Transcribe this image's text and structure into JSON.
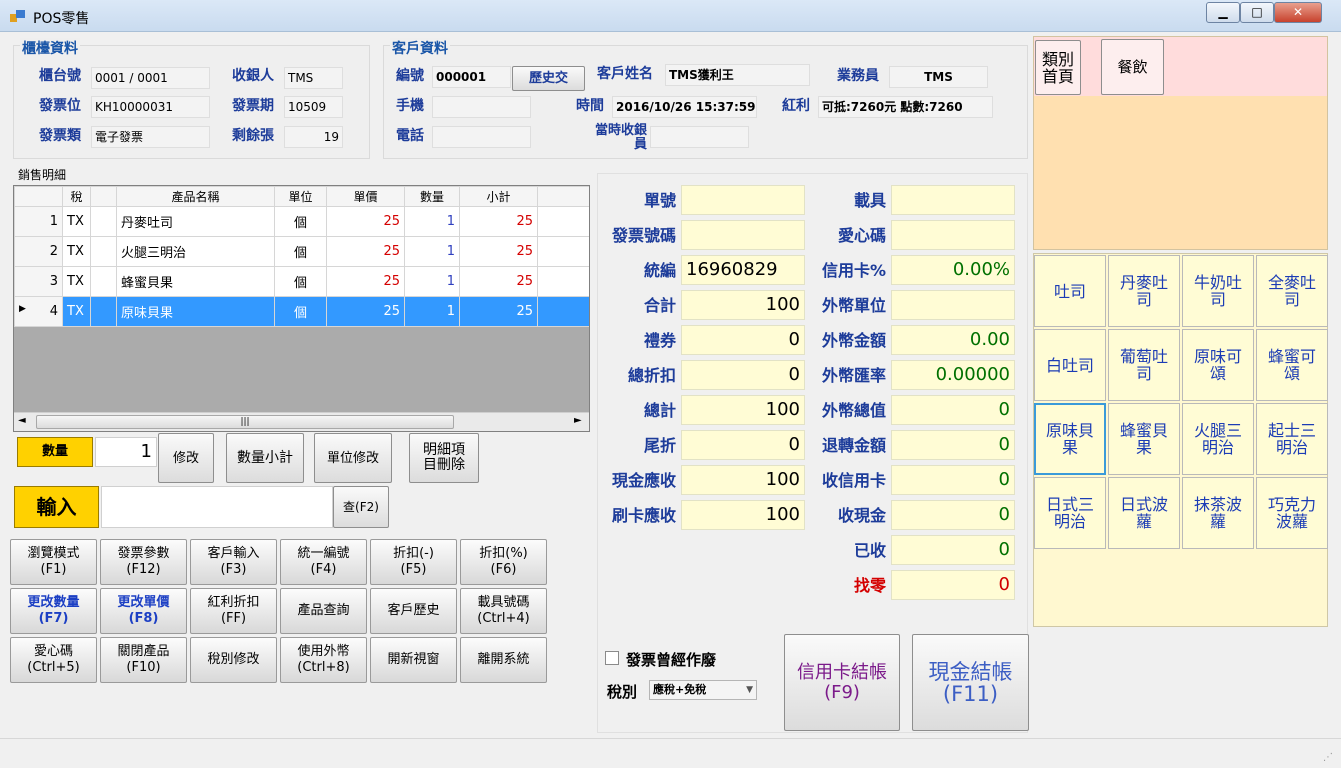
{
  "window": {
    "title": "POS零售",
    "min": "▁",
    "max": "□",
    "close": "✕"
  },
  "counter": {
    "group": "櫃檯資料",
    "counter_no_label": "櫃台號",
    "counter_no": "0001 / 0001",
    "cashier_label": "收銀人",
    "cashier": "TMS",
    "invoice_pos_label": "發票位",
    "invoice_pos": "KH10000031",
    "invoice_period_label": "發票期",
    "invoice_period": "10509",
    "invoice_type_label": "發票類",
    "invoice_type": "電子發票",
    "remaining_label": "剩餘張",
    "remaining": "19"
  },
  "customer": {
    "group": "客戶資料",
    "id_label": "編號",
    "id": "000001",
    "history_button": "歷史交",
    "name_label": "客戶姓名",
    "name": "TMS獲利王",
    "sales_label": "業務員",
    "sales": "TMS",
    "phone_label": "手機",
    "phone": "",
    "time_label": "時間",
    "time": "2016/10/26 15:37:59",
    "bonus_label": "紅利",
    "bonus": "可抵:7260元 點數:7260",
    "tel_label": "電話",
    "tel": "",
    "cashier_at_time_label": "當時收銀員",
    "cashier_at_time": ""
  },
  "sales": {
    "title": "銷售明細",
    "columns": [
      "",
      "稅",
      "",
      "產品名稱",
      "單位",
      "單價",
      "數量",
      "小計"
    ],
    "rows": [
      {
        "no": "1",
        "tax": "TX",
        "name": "丹麥吐司",
        "unit": "個",
        "price": "25",
        "qty": "1",
        "subtotal": "25"
      },
      {
        "no": "2",
        "tax": "TX",
        "name": "火腿三明治",
        "unit": "個",
        "price": "25",
        "qty": "1",
        "subtotal": "25"
      },
      {
        "no": "3",
        "tax": "TX",
        "name": "蜂蜜貝果",
        "unit": "個",
        "price": "25",
        "qty": "1",
        "subtotal": "25"
      },
      {
        "no": "4",
        "tax": "TX",
        "name": "原味貝果",
        "unit": "個",
        "price": "25",
        "qty": "1",
        "subtotal": "25"
      }
    ],
    "scroll_mid": "|||",
    "scroll_left": "◄",
    "scroll_right": "►",
    "row_marker": "▶"
  },
  "qty": {
    "label": "數量",
    "value": "1",
    "modify": "修改",
    "qty_subtotal": "數量小計",
    "unit_modify": "單位修改",
    "delete_line": "明細項\n目刪除"
  },
  "input": {
    "label": "輸入",
    "value": "",
    "query": "查(F2)"
  },
  "fkeys": [
    {
      "label": "瀏覽模式\n(F1)"
    },
    {
      "label": "發票參數\n(F12)"
    },
    {
      "label": "客戶輸入\n(F3)"
    },
    {
      "label": "統一編號\n(F4)"
    },
    {
      "label": "折扣(-)\n(F5)"
    },
    {
      "label": "折扣(%)\n(F6)"
    },
    {
      "label": "更改數量\n(F7)",
      "blue": true
    },
    {
      "label": "更改單價\n(F8)",
      "blue": true
    },
    {
      "label": "紅利折扣\n(FF)"
    },
    {
      "label": "產品查詢"
    },
    {
      "label": "客戶歷史"
    },
    {
      "label": "載具號碼\n(Ctrl+4)"
    },
    {
      "label": "愛心碼\n(Ctrl+5)"
    },
    {
      "label": "關閉產品\n(F10)"
    },
    {
      "label": "稅別修改"
    },
    {
      "label": "使用外幣\n(Ctrl+8)"
    },
    {
      "label": "開新視窗"
    },
    {
      "label": "離開系統"
    }
  ],
  "summary": {
    "left": [
      {
        "label": "單號",
        "value": ""
      },
      {
        "label": "發票號碼",
        "value": ""
      },
      {
        "label": "統編",
        "value": "16960829",
        "left": true
      },
      {
        "label": "合計",
        "value": "100"
      },
      {
        "label": "禮券",
        "value": "0"
      },
      {
        "label": "總折扣",
        "value": "0"
      },
      {
        "label": "總計",
        "value": "100"
      },
      {
        "label": "尾折",
        "value": "0"
      },
      {
        "label": "現金應收",
        "value": "100"
      },
      {
        "label": "刷卡應收",
        "value": "100"
      }
    ],
    "right": [
      {
        "label": "載具",
        "value": ""
      },
      {
        "label": "愛心碼",
        "value": ""
      },
      {
        "label": "信用卡%",
        "value": "0.00%"
      },
      {
        "label": "外幣單位",
        "value": ""
      },
      {
        "label": "外幣金額",
        "value": "0.00"
      },
      {
        "label": "外幣匯率",
        "value": "0.00000"
      },
      {
        "label": "外幣總值",
        "value": "0"
      },
      {
        "label": "退轉金額",
        "value": "0"
      },
      {
        "label": "收信用卡",
        "value": "0"
      },
      {
        "label": "收現金",
        "value": "0"
      },
      {
        "label": "已收",
        "value": "0"
      },
      {
        "label": "找零",
        "value": "0",
        "red": true
      }
    ],
    "void_label": "發票曾經作廢",
    "tax_type_label": "稅別",
    "tax_type": "應稅+免稅",
    "card_checkout": "信用卡結帳\n(F9)",
    "cash_checkout": "現金結帳\n(F11)"
  },
  "categories": {
    "home": "類別\n首頁",
    "food": "餐飲"
  },
  "products": [
    "吐司",
    "丹麥吐\n司",
    "牛奶吐\n司",
    "全麥吐\n司",
    "白吐司",
    "葡萄吐\n司",
    "原味可\n頌",
    "蜂蜜可\n頌",
    "原味貝\n果",
    "蜂蜜貝\n果",
    "火腿三\n明治",
    "起士三\n明治",
    "日式三\n明治",
    "日式波\n蘿",
    "抹茶波\n蘿",
    "巧克力\n波蘿"
  ]
}
